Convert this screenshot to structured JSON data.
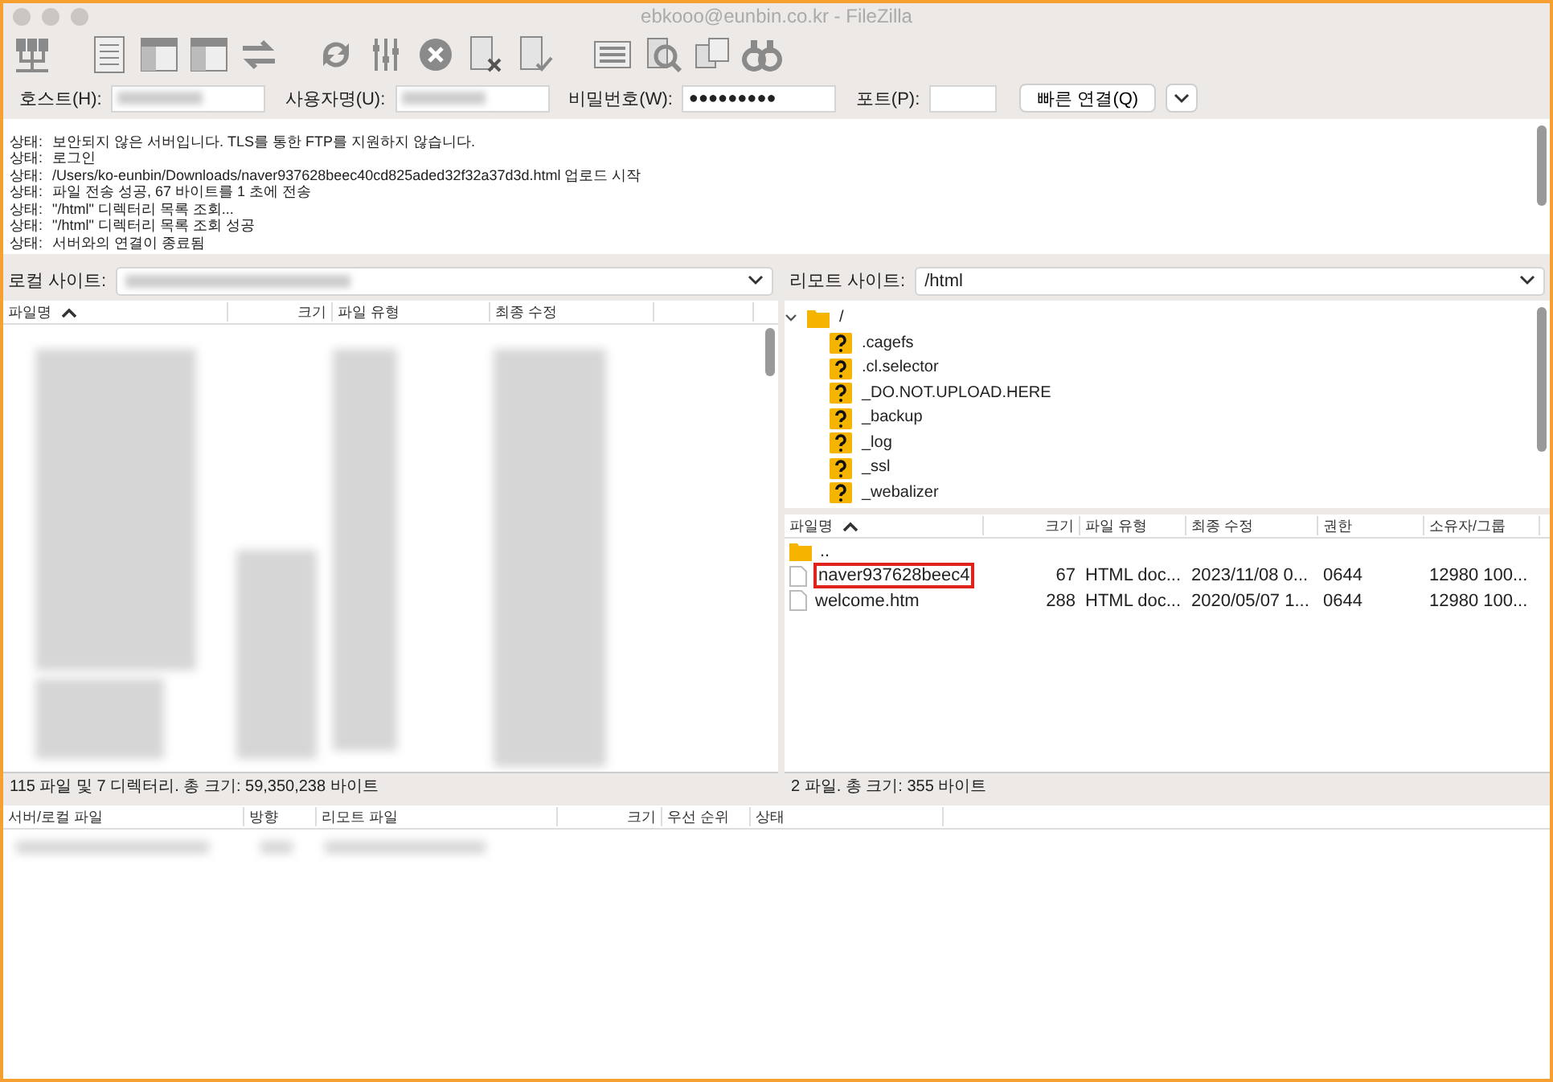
{
  "window": {
    "title": "ebkooo@eunbin.co.kr - FileZilla"
  },
  "quickconnect": {
    "fields": [
      {
        "label": "호스트(H):",
        "kind": "blurred"
      },
      {
        "label": "사용자명(U):",
        "kind": "blurred"
      },
      {
        "label": "비밀번호(W):",
        "kind": "password",
        "value": "●●●●●●●●●"
      },
      {
        "label": "포트(P):",
        "kind": "empty"
      }
    ],
    "button": "빠른 연결(Q)"
  },
  "log": [
    {
      "label": "상태:",
      "text": "보안되지 않은 서버입니다. TLS를 통한 FTP를 지원하지 않습니다."
    },
    {
      "label": "상태:",
      "text": "로그인"
    },
    {
      "label": "상태:",
      "text": "/Users/ko-eunbin/Downloads/naver937628beec40cd825aded32f32a37d3d.html 업로드 시작"
    },
    {
      "label": "상태:",
      "text": "파일 전송 성공, 67 바이트를 1 초에 전송"
    },
    {
      "label": "상태:",
      "text": "\"/html\" 디렉터리 목록 조회..."
    },
    {
      "label": "상태:",
      "text": "\"/html\" 디렉터리 목록 조회 성공"
    },
    {
      "label": "상태:",
      "text": "서버와의 연결이 종료됨"
    }
  ],
  "local": {
    "site_label": "로컬 사이트:",
    "columns": [
      {
        "label": "파일명",
        "sorted": true
      },
      {
        "label": "크기",
        "sorted": false
      },
      {
        "label": "파일 유형",
        "sorted": false
      },
      {
        "label": "최종 수정",
        "sorted": false
      }
    ],
    "status": "115 파일 및 7 디렉터리. 총 크기: 59,350,238 바이트"
  },
  "remote": {
    "site_label": "리모트 사이트:",
    "path": "/html",
    "tree": [
      {
        "name": "/",
        "kind": "folder",
        "expanded": true,
        "children": [
          {
            "name": ".cagefs",
            "kind": "unknown"
          },
          {
            "name": ".cl.selector",
            "kind": "unknown"
          },
          {
            "name": "_DO.NOT.UPLOAD.HERE",
            "kind": "unknown"
          },
          {
            "name": "_backup",
            "kind": "unknown"
          },
          {
            "name": "_log",
            "kind": "unknown"
          },
          {
            "name": "_ssl",
            "kind": "unknown"
          },
          {
            "name": "_webalizer",
            "kind": "unknown"
          }
        ]
      }
    ],
    "columns": [
      {
        "label": "파일명",
        "sorted": true
      },
      {
        "label": "크기",
        "sorted": false
      },
      {
        "label": "파일 유형",
        "sorted": false
      },
      {
        "label": "최종 수정",
        "sorted": false
      },
      {
        "label": "권한",
        "sorted": false
      },
      {
        "label": "소유자/그룹",
        "sorted": false
      }
    ],
    "rows": [
      {
        "kind": "parent",
        "name": "..",
        "highlighted": false
      },
      {
        "kind": "file",
        "name": "naver937628beec4",
        "size": "67",
        "type": "HTML doc...",
        "modified": "2023/11/08 0...",
        "perms": "0644",
        "owner": "12980 100...",
        "highlighted": true
      },
      {
        "kind": "file",
        "name": "welcome.htm",
        "size": "288",
        "type": "HTML doc...",
        "modified": "2020/05/07 1...",
        "perms": "0644",
        "owner": "12980 100...",
        "highlighted": false
      }
    ],
    "status": "2 파일. 총 크기: 355 바이트"
  },
  "queue": {
    "columns": [
      {
        "label": "서버/로컬 파일"
      },
      {
        "label": "방향"
      },
      {
        "label": "리모트 파일"
      },
      {
        "label": "크기"
      },
      {
        "label": "우선 순위"
      },
      {
        "label": "상태"
      }
    ]
  }
}
